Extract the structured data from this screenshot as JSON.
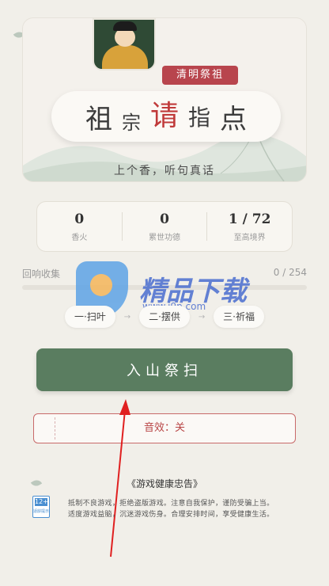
{
  "hero": {
    "badge": "清明祭祖",
    "title_chars": [
      "祖",
      "宗",
      "请",
      "指",
      "点"
    ],
    "subtitle": "上个香，听句真话"
  },
  "stats": [
    {
      "value": "0",
      "label": "香火"
    },
    {
      "value": "0",
      "label": "累世功德"
    },
    {
      "value": "1 / 72",
      "label": "至高境界"
    }
  ],
  "collect": {
    "label": "回响收集",
    "count": "0 / 254",
    "progress": 0
  },
  "watermark": {
    "text": "精品下载",
    "url": "www.j9p.com"
  },
  "steps": [
    {
      "label": "一·扫叶"
    },
    {
      "label": "二·摆供"
    },
    {
      "label": "三·祈福"
    }
  ],
  "step_arrow": "→",
  "main_button": "入山祭扫",
  "sound_button": "音效：关",
  "notice": {
    "title": "《游戏健康忠告》",
    "age_rating": "12+",
    "age_rating_caption": "适龄提示",
    "line1": "抵制不良游戏，拒绝盗版游戏。注意自我保护，谨防受骗上当。",
    "line2": "适度游戏益脑，沉迷游戏伤身。合理安排时间，享受健康生活。"
  },
  "colors": {
    "accent_green": "#5a7d60",
    "accent_red": "#b8454d",
    "background": "#f1efe9"
  }
}
